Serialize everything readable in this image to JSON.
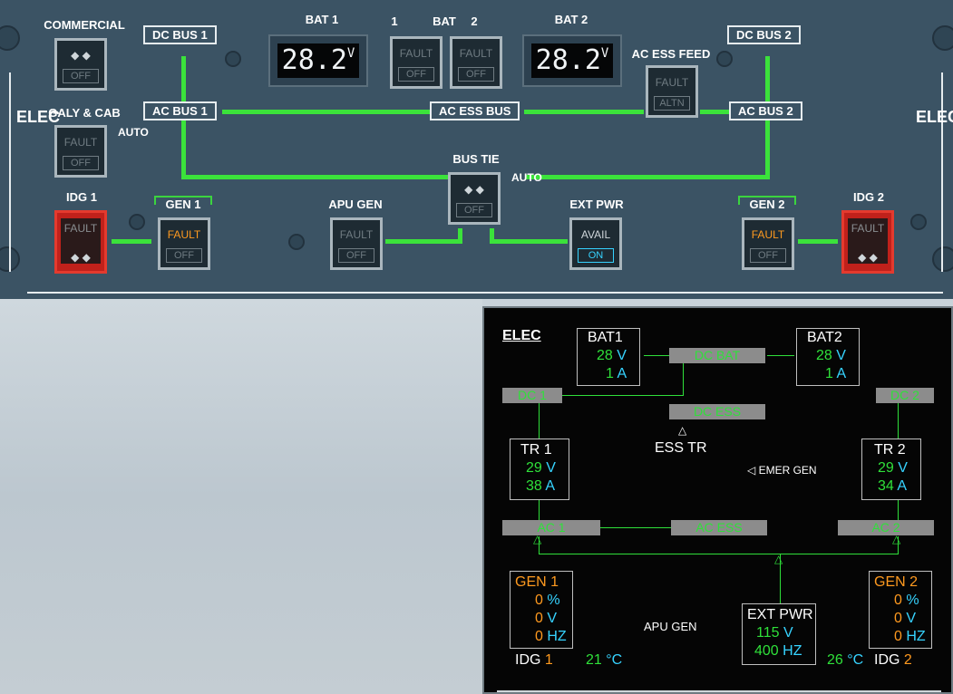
{
  "panel": {
    "elec_left": "ELEC",
    "elec_right": "ELEC",
    "commercial": {
      "title": "COMMERCIAL",
      "top": "◆ ◆",
      "bottom": "OFF"
    },
    "galy_cab": {
      "title": "GALY & CAB",
      "top": "FAULT",
      "bottom": "OFF",
      "auto": "AUTO"
    },
    "idg1": {
      "title": "IDG 1",
      "top": "FAULT",
      "bottom": "◆ ◆"
    },
    "idg2": {
      "title": "IDG 2",
      "top": "FAULT",
      "bottom": "◆ ◆"
    },
    "gen1": {
      "title": "GEN 1",
      "top": "FAULT",
      "bottom": "OFF"
    },
    "gen2": {
      "title": "GEN 2",
      "top": "FAULT",
      "bottom": "OFF"
    },
    "apu_gen": {
      "title": "APU GEN",
      "top": "FAULT",
      "bottom": "OFF"
    },
    "ext_pwr": {
      "title": "EXT PWR",
      "top": "AVAIL",
      "bottom": "ON"
    },
    "bus_tie": {
      "title": "BUS TIE",
      "top": "◆ ◆",
      "bottom": "OFF",
      "auto": "AUTO"
    },
    "ac_ess_feed": {
      "title": "AC ESS FEED",
      "top": "FAULT",
      "bottom": "ALTN"
    },
    "bat1": {
      "title": "BAT 1",
      "value": "28.2",
      "unit": "V"
    },
    "bat2": {
      "title": "BAT 2",
      "value": "28.2",
      "unit": "V"
    },
    "bat_pb": {
      "title_1": "1",
      "title_mid": "BAT",
      "title_2": "2",
      "top": "FAULT",
      "bottom": "OFF"
    },
    "buses": {
      "dc_bus_1": "DC BUS 1",
      "dc_bus_2": "DC BUS 2",
      "ac_bus_1": "AC BUS 1",
      "ac_bus_2": "AC BUS 2",
      "ac_ess_bus": "AC ESS BUS"
    }
  },
  "ecam": {
    "title": "ELEC",
    "bat1": {
      "label": "BAT1",
      "volts": "28",
      "v_unit": "V",
      "amps": "1",
      "a_unit": "A"
    },
    "bat2": {
      "label": "BAT2",
      "volts": "28",
      "v_unit": "V",
      "amps": "1",
      "a_unit": "A"
    },
    "dc_bat": "DC BAT",
    "dc1": "DC 1",
    "dc2": "DC 2",
    "dc_ess": "DC ESS",
    "ess_tr": "ESS TR",
    "emer_gen": "EMER GEN",
    "tr1": {
      "label": "TR 1",
      "volts": "29",
      "v_unit": "V",
      "amps": "38",
      "a_unit": "A"
    },
    "tr2": {
      "label": "TR 2",
      "volts": "29",
      "v_unit": "V",
      "amps": "34",
      "a_unit": "A"
    },
    "ac1": "AC 1",
    "ac2": "AC 2",
    "ac_ess": "AC ESS",
    "gen1": {
      "label": "GEN 1",
      "load": "0",
      "load_unit": "%",
      "volts": "0",
      "v_unit": "V",
      "freq": "0",
      "f_unit": "HZ"
    },
    "gen2": {
      "label": "GEN 2",
      "load": "0",
      "load_unit": "%",
      "volts": "0",
      "v_unit": "V",
      "freq": "0",
      "f_unit": "HZ"
    },
    "apu_gen": "APU GEN",
    "ext_pwr": {
      "label": "EXT PWR",
      "volts": "115",
      "v_unit": "V",
      "freq": "400",
      "f_unit": "HZ"
    },
    "idg1": {
      "label": "IDG",
      "num": "1",
      "temp": "21",
      "unit": "°C"
    },
    "idg2": {
      "label": "IDG",
      "num": "2",
      "temp": "26",
      "unit": "°C"
    }
  },
  "colors": {
    "panel": "#3b5364",
    "green": "#2fe03a",
    "amber": "#ff9a1f",
    "cyan": "#36d3ff"
  }
}
